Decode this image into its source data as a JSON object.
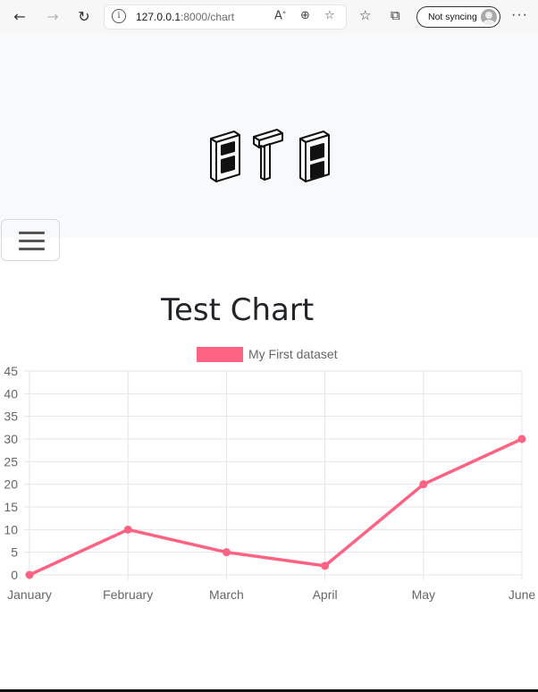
{
  "browser": {
    "url_host": "127.0.0.1",
    "url_rest": ":8000/chart",
    "sync_label": "Not syncing"
  },
  "page": {
    "title": "Test Chart"
  },
  "chart_data": {
    "type": "line",
    "title": "Test Chart",
    "categories": [
      "January",
      "February",
      "March",
      "April",
      "May",
      "June"
    ],
    "series": [
      {
        "name": "My First dataset",
        "values": [
          0,
          10,
          5,
          2,
          20,
          30
        ],
        "color": "#ff6384"
      }
    ],
    "ylim": [
      0,
      45
    ],
    "yticks": [
      0,
      5,
      10,
      15,
      20,
      25,
      30,
      35,
      40,
      45
    ],
    "grid": true,
    "legend_position": "top"
  }
}
